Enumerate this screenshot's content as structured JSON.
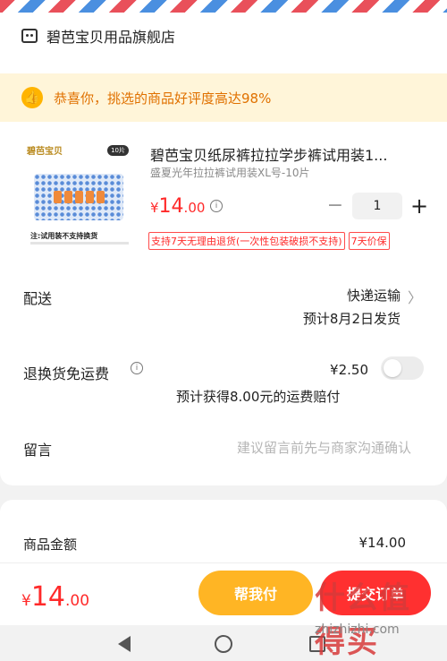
{
  "store": {
    "name": "碧芭宝贝用品旗舰店"
  },
  "banner": {
    "text": "恭喜你，挑选的商品好评度高达98%"
  },
  "product": {
    "image": {
      "brand": "碧芭宝贝",
      "tag": "10片",
      "note": "注:试用装不支持换货"
    },
    "title": "碧芭宝贝纸尿裤拉拉学步裤试用装1...",
    "spec": "盛夏光年拉拉裤试用装XL号-10片",
    "price": {
      "currency": "¥",
      "integer": "14",
      "decimal": ".00"
    },
    "quantity": "1",
    "badges": [
      "支持7天无理由退货(一次性包装破损不支持)",
      "7天价保"
    ]
  },
  "shipping": {
    "label": "配送",
    "method": "快递运输",
    "date": "预计8月2日发货"
  },
  "returns": {
    "label": "退换货免运费",
    "price": "¥2.50",
    "compensation": "预计获得8.00元的运费赔付",
    "toggle_on": false
  },
  "message": {
    "label": "留言",
    "placeholder": "建议留言前先与商家沟通确认"
  },
  "amount": {
    "label": "商品金额",
    "value": "¥14.00"
  },
  "footer": {
    "total": {
      "currency": "¥",
      "integer": "14",
      "decimal": ".00"
    },
    "help_pay": "帮我付",
    "submit": "提交订单"
  },
  "watermark": {
    "logo": "什么值得买",
    "url": "zhizhizhi.com"
  },
  "colors": {
    "accent_red": "#ff2a2a",
    "accent_orange": "#ffb524",
    "banner_bg": "#fff5d9"
  }
}
